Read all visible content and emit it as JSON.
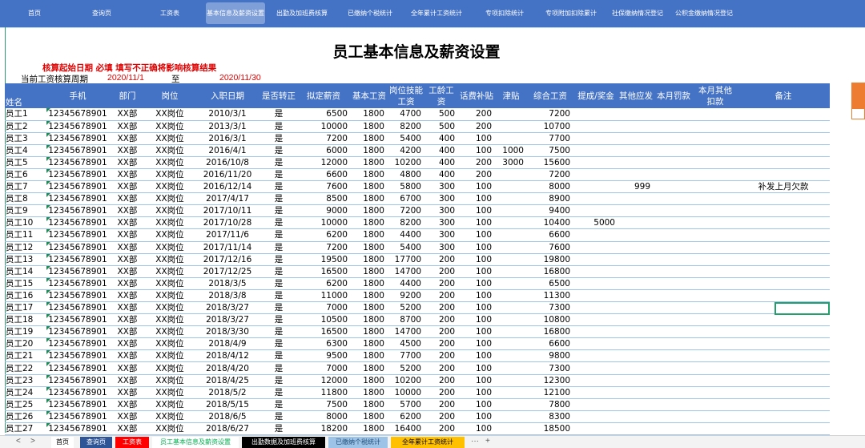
{
  "nav_tabs": [
    {
      "label": "首页"
    },
    {
      "label": "查询页"
    },
    {
      "label": "工资表"
    },
    {
      "label": "基本信息及薪资设置"
    },
    {
      "label": "出勤及加班费核算"
    },
    {
      "label": "已缴纳个税统计"
    },
    {
      "label": "全年累计工资统计"
    },
    {
      "label": "专项扣除统计"
    },
    {
      "label": "专项附加扣除累计"
    },
    {
      "label": "社保缴纳情况登记"
    },
    {
      "label": "公积金缴纳情况登记"
    }
  ],
  "active_nav_tab": "基本信息及薪资设置",
  "page_title": "员工基本信息及薪资设置",
  "warning": "核算起始日期 必填 填写不正确将影响核算结果",
  "period": {
    "label": "当前工资核算周期",
    "start": "2020/11/1",
    "to": "至",
    "end": "2020/11/30"
  },
  "table": {
    "columns": [
      "姓名",
      "手机",
      "部门",
      "岗位",
      "入职日期",
      "是否转正",
      "拟定薪资",
      "基本工资",
      "岗位技能工资",
      "工龄工资",
      "话费补贴",
      "津贴",
      "综合工资",
      "提成/奖金",
      "其他应发",
      "本月罚款",
      "本月其他扣款",
      "备注"
    ],
    "rows": [
      [
        "员工1",
        "12345678901",
        "XX部",
        "XX岗位",
        "2010/3/1",
        "是",
        "6500",
        "1800",
        "4700",
        "500",
        "200",
        "",
        "7200",
        "",
        "",
        "",
        "",
        ""
      ],
      [
        "员工2",
        "12345678901",
        "XX部",
        "XX岗位",
        "2013/3/1",
        "是",
        "10000",
        "1800",
        "8200",
        "500",
        "200",
        "",
        "10700",
        "",
        "",
        "",
        "",
        ""
      ],
      [
        "员工3",
        "12345678901",
        "XX部",
        "XX岗位",
        "2016/3/1",
        "是",
        "7200",
        "1800",
        "5400",
        "400",
        "100",
        "",
        "7700",
        "",
        "",
        "",
        "",
        ""
      ],
      [
        "员工4",
        "12345678901",
        "XX部",
        "XX岗位",
        "2016/4/1",
        "是",
        "6000",
        "1800",
        "4200",
        "400",
        "100",
        "1000",
        "7500",
        "",
        "",
        "",
        "",
        ""
      ],
      [
        "员工5",
        "12345678901",
        "XX部",
        "XX岗位",
        "2016/10/8",
        "是",
        "12000",
        "1800",
        "10200",
        "400",
        "200",
        "3000",
        "15600",
        "",
        "",
        "",
        "",
        ""
      ],
      [
        "员工6",
        "12345678901",
        "XX部",
        "XX岗位",
        "2016/11/20",
        "是",
        "6600",
        "1800",
        "4800",
        "400",
        "200",
        "",
        "7200",
        "",
        "",
        "",
        "",
        ""
      ],
      [
        "员工7",
        "12345678901",
        "XX部",
        "XX岗位",
        "2016/12/14",
        "是",
        "7600",
        "1800",
        "5800",
        "300",
        "100",
        "",
        "8000",
        "",
        "999",
        "",
        "",
        "补发上月欠款"
      ],
      [
        "员工8",
        "12345678901",
        "XX部",
        "XX岗位",
        "2017/4/17",
        "是",
        "8500",
        "1800",
        "6700",
        "300",
        "100",
        "",
        "8900",
        "",
        "",
        "",
        "",
        ""
      ],
      [
        "员工9",
        "12345678901",
        "XX部",
        "XX岗位",
        "2017/10/11",
        "是",
        "9000",
        "1800",
        "7200",
        "300",
        "100",
        "",
        "9400",
        "",
        "",
        "",
        "",
        ""
      ],
      [
        "员工10",
        "12345678901",
        "XX部",
        "XX岗位",
        "2017/10/28",
        "是",
        "10000",
        "1800",
        "8200",
        "300",
        "100",
        "",
        "10400",
        "5000",
        "",
        "",
        "",
        ""
      ],
      [
        "员工11",
        "12345678901",
        "XX部",
        "XX岗位",
        "2017/11/6",
        "是",
        "6200",
        "1800",
        "4400",
        "300",
        "100",
        "",
        "6600",
        "",
        "",
        "",
        "",
        ""
      ],
      [
        "员工12",
        "12345678901",
        "XX部",
        "XX岗位",
        "2017/11/14",
        "是",
        "7200",
        "1800",
        "5400",
        "300",
        "100",
        "",
        "7600",
        "",
        "",
        "",
        "",
        ""
      ],
      [
        "员工13",
        "12345678901",
        "XX部",
        "XX岗位",
        "2017/12/16",
        "是",
        "19500",
        "1800",
        "17700",
        "200",
        "100",
        "",
        "19800",
        "",
        "",
        "",
        "",
        ""
      ],
      [
        "员工14",
        "12345678901",
        "XX部",
        "XX岗位",
        "2017/12/25",
        "是",
        "16500",
        "1800",
        "14700",
        "200",
        "100",
        "",
        "16800",
        "",
        "",
        "",
        "",
        ""
      ],
      [
        "员工15",
        "12345678901",
        "XX部",
        "XX岗位",
        "2018/3/5",
        "是",
        "6200",
        "1800",
        "4400",
        "200",
        "100",
        "",
        "6500",
        "",
        "",
        "",
        "",
        ""
      ],
      [
        "员工16",
        "12345678901",
        "XX部",
        "XX岗位",
        "2018/3/8",
        "是",
        "11000",
        "1800",
        "9200",
        "200",
        "100",
        "",
        "11300",
        "",
        "",
        "",
        "",
        ""
      ],
      [
        "员工17",
        "12345678901",
        "XX部",
        "XX岗位",
        "2018/3/27",
        "是",
        "7000",
        "1800",
        "5200",
        "200",
        "100",
        "",
        "7300",
        "",
        "",
        "",
        "",
        ""
      ],
      [
        "员工18",
        "12345678901",
        "XX部",
        "XX岗位",
        "2018/3/27",
        "是",
        "10500",
        "1800",
        "8700",
        "200",
        "100",
        "",
        "10800",
        "",
        "",
        "",
        "",
        ""
      ],
      [
        "员工19",
        "12345678901",
        "XX部",
        "XX岗位",
        "2018/3/30",
        "是",
        "16500",
        "1800",
        "14700",
        "200",
        "100",
        "",
        "16800",
        "",
        "",
        "",
        "",
        ""
      ],
      [
        "员工20",
        "12345678901",
        "XX部",
        "XX岗位",
        "2018/4/9",
        "是",
        "6300",
        "1800",
        "4500",
        "200",
        "100",
        "",
        "6600",
        "",
        "",
        "",
        "",
        ""
      ],
      [
        "员工21",
        "12345678901",
        "XX部",
        "XX岗位",
        "2018/4/12",
        "是",
        "9500",
        "1800",
        "7700",
        "200",
        "100",
        "",
        "9800",
        "",
        "",
        "",
        "",
        ""
      ],
      [
        "员工22",
        "12345678901",
        "XX部",
        "XX岗位",
        "2018/4/20",
        "是",
        "7000",
        "1800",
        "5200",
        "200",
        "100",
        "",
        "7300",
        "",
        "",
        "",
        "",
        ""
      ],
      [
        "员工23",
        "12345678901",
        "XX部",
        "XX岗位",
        "2018/4/25",
        "是",
        "12000",
        "1800",
        "10200",
        "200",
        "100",
        "",
        "12300",
        "",
        "",
        "",
        "",
        ""
      ],
      [
        "员工24",
        "12345678901",
        "XX部",
        "XX岗位",
        "2018/5/2",
        "是",
        "11800",
        "1800",
        "10000",
        "200",
        "100",
        "",
        "12100",
        "",
        "",
        "",
        "",
        ""
      ],
      [
        "员工25",
        "12345678901",
        "XX部",
        "XX岗位",
        "2018/5/15",
        "是",
        "7500",
        "1800",
        "5700",
        "200",
        "100",
        "",
        "7800",
        "",
        "",
        "",
        "",
        ""
      ],
      [
        "员工26",
        "12345678901",
        "XX部",
        "XX岗位",
        "2018/6/5",
        "是",
        "8000",
        "1800",
        "6200",
        "200",
        "100",
        "",
        "8300",
        "",
        "",
        "",
        "",
        ""
      ],
      [
        "员工27",
        "12345678901",
        "XX部",
        "XX岗位",
        "2018/6/27",
        "是",
        "18200",
        "1800",
        "16400",
        "200",
        "100",
        "",
        "18500",
        "",
        "",
        "",
        "",
        ""
      ]
    ]
  },
  "sheet_tabs": [
    {
      "label": "首页",
      "bg": "#ffffff",
      "color": "#000000"
    },
    {
      "label": "查询页",
      "bg": "#2f5597",
      "color": "#ffffff"
    },
    {
      "label": "工资表",
      "bg": "#ff0000",
      "color": "#ffffff"
    },
    {
      "label": "员工基本信息及薪资设置",
      "bg": "#ffffff",
      "color": "#00b050"
    },
    {
      "label": "出勤数据及加班费核算",
      "bg": "#000000",
      "color": "#ffffff"
    },
    {
      "label": "已缴纳个税统计",
      "bg": "#9dc3e6",
      "color": "#1f4e79"
    },
    {
      "label": "全年累计工资统计",
      "bg": "#ffc000",
      "color": "#000000"
    }
  ],
  "sheet_bar": {
    "prev": "<",
    "next": ">",
    "more": "···",
    "add": "+"
  },
  "colors": {
    "header_blue": "#4472c4",
    "alert_red": "#e00000",
    "accent_orange": "#ed7d31",
    "select_green": "#22a06b"
  }
}
